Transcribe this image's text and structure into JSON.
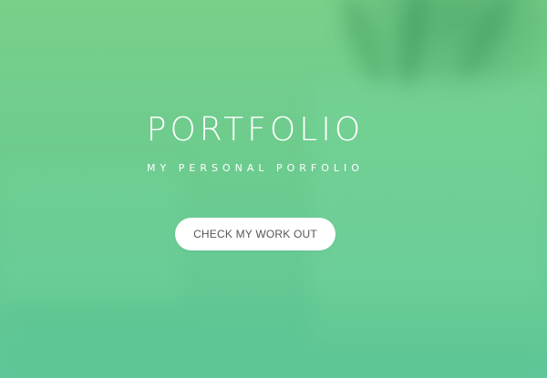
{
  "hero": {
    "title": "PORTFOLIO",
    "subtitle": "MY PERSONAL PORFOLIO",
    "cta_label": "CHECK MY WORK OUT"
  },
  "colors": {
    "background": "#6ccb8e",
    "text": "#ffffff",
    "button_bg": "#ffffff",
    "button_text": "#555555"
  }
}
